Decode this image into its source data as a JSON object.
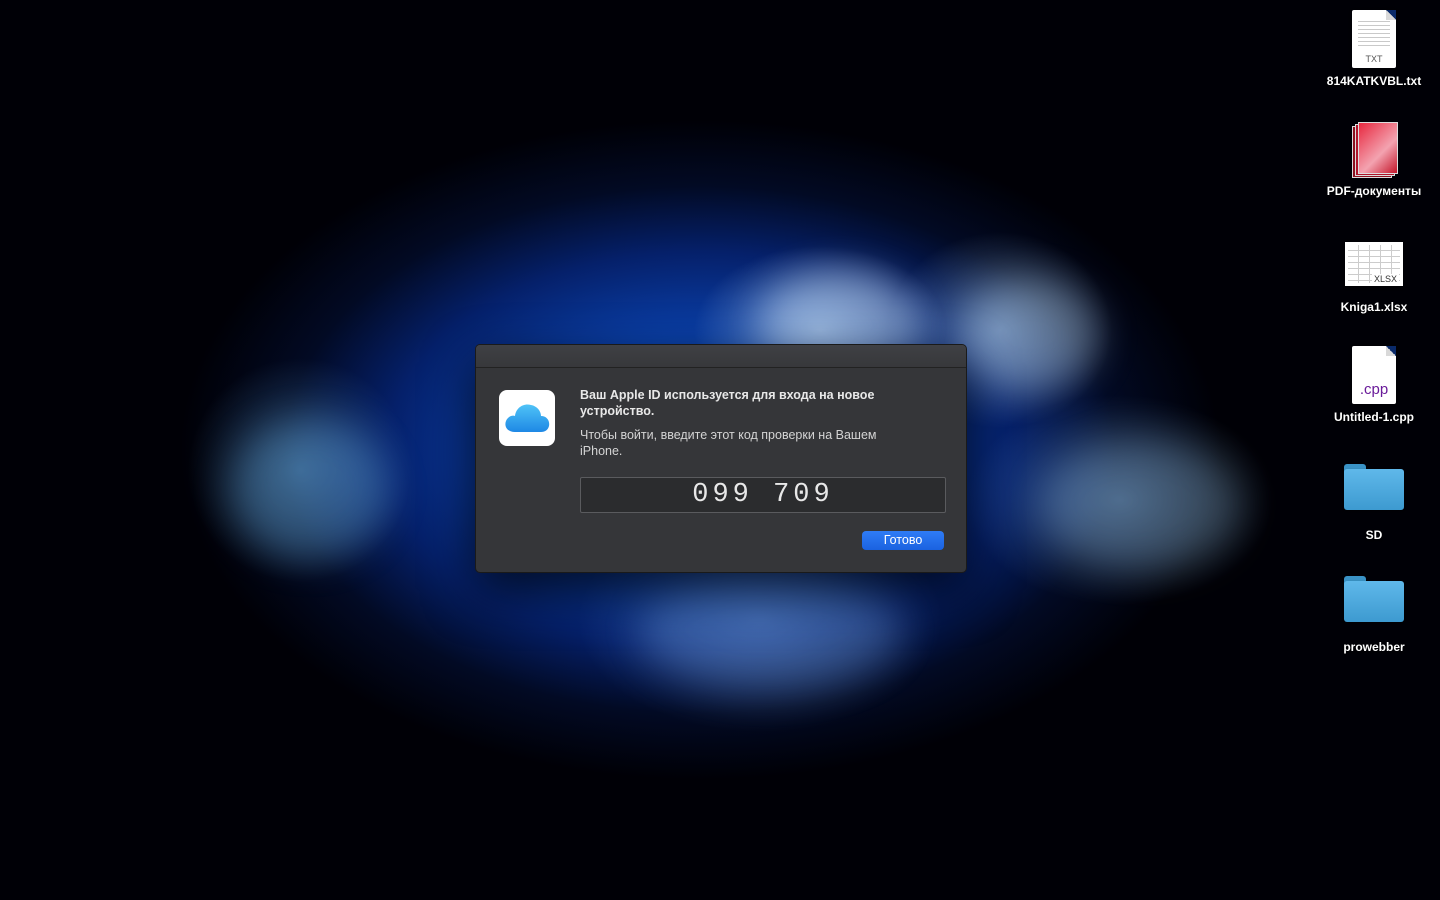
{
  "dialog": {
    "title": "Ваш Apple ID используется для входа на новое устройство.",
    "message": "Чтобы войти, введите этот код проверки на Вашем iPhone.",
    "code": "099 709",
    "done_label": "Готово",
    "icon": "icloud-icon"
  },
  "desktop_icons": [
    {
      "label": "814KATKVBL.txt",
      "icon": "txt-file-icon",
      "ext": "TXT"
    },
    {
      "label": "PDF-документы",
      "icon": "pdf-documents-icon"
    },
    {
      "label": "Kniga1.xlsx",
      "icon": "xlsx-file-icon",
      "ext": "XLSX"
    },
    {
      "label": "Untitled-1.cpp",
      "icon": "cpp-file-icon",
      "ext": ".cpp"
    },
    {
      "label": "SD",
      "icon": "folder-icon"
    },
    {
      "label": "prowebber",
      "icon": "folder-icon"
    }
  ],
  "colors": {
    "accent_button": "#1a62e0",
    "dialog_bg": "#353639",
    "folder": "#4aa6db"
  }
}
